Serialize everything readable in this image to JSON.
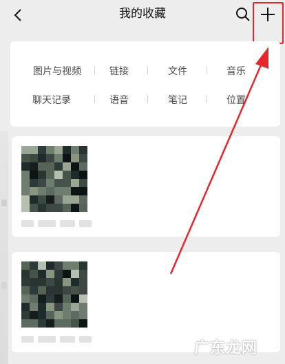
{
  "header": {
    "title": "我的收藏",
    "back_icon": "chevron-left-icon",
    "search_icon": "search-icon",
    "add_icon": "plus-icon"
  },
  "filters": {
    "row1": [
      "图片与视频",
      "链接",
      "文件",
      "音乐"
    ],
    "row2": [
      "聊天记录",
      "语音",
      "笔记",
      "位置"
    ]
  },
  "annotation": {
    "color": "#e8262b"
  },
  "watermark": "广东龙网",
  "colors": {
    "background": "#ededed",
    "card": "#ffffff",
    "text": "#4a4a4a"
  }
}
